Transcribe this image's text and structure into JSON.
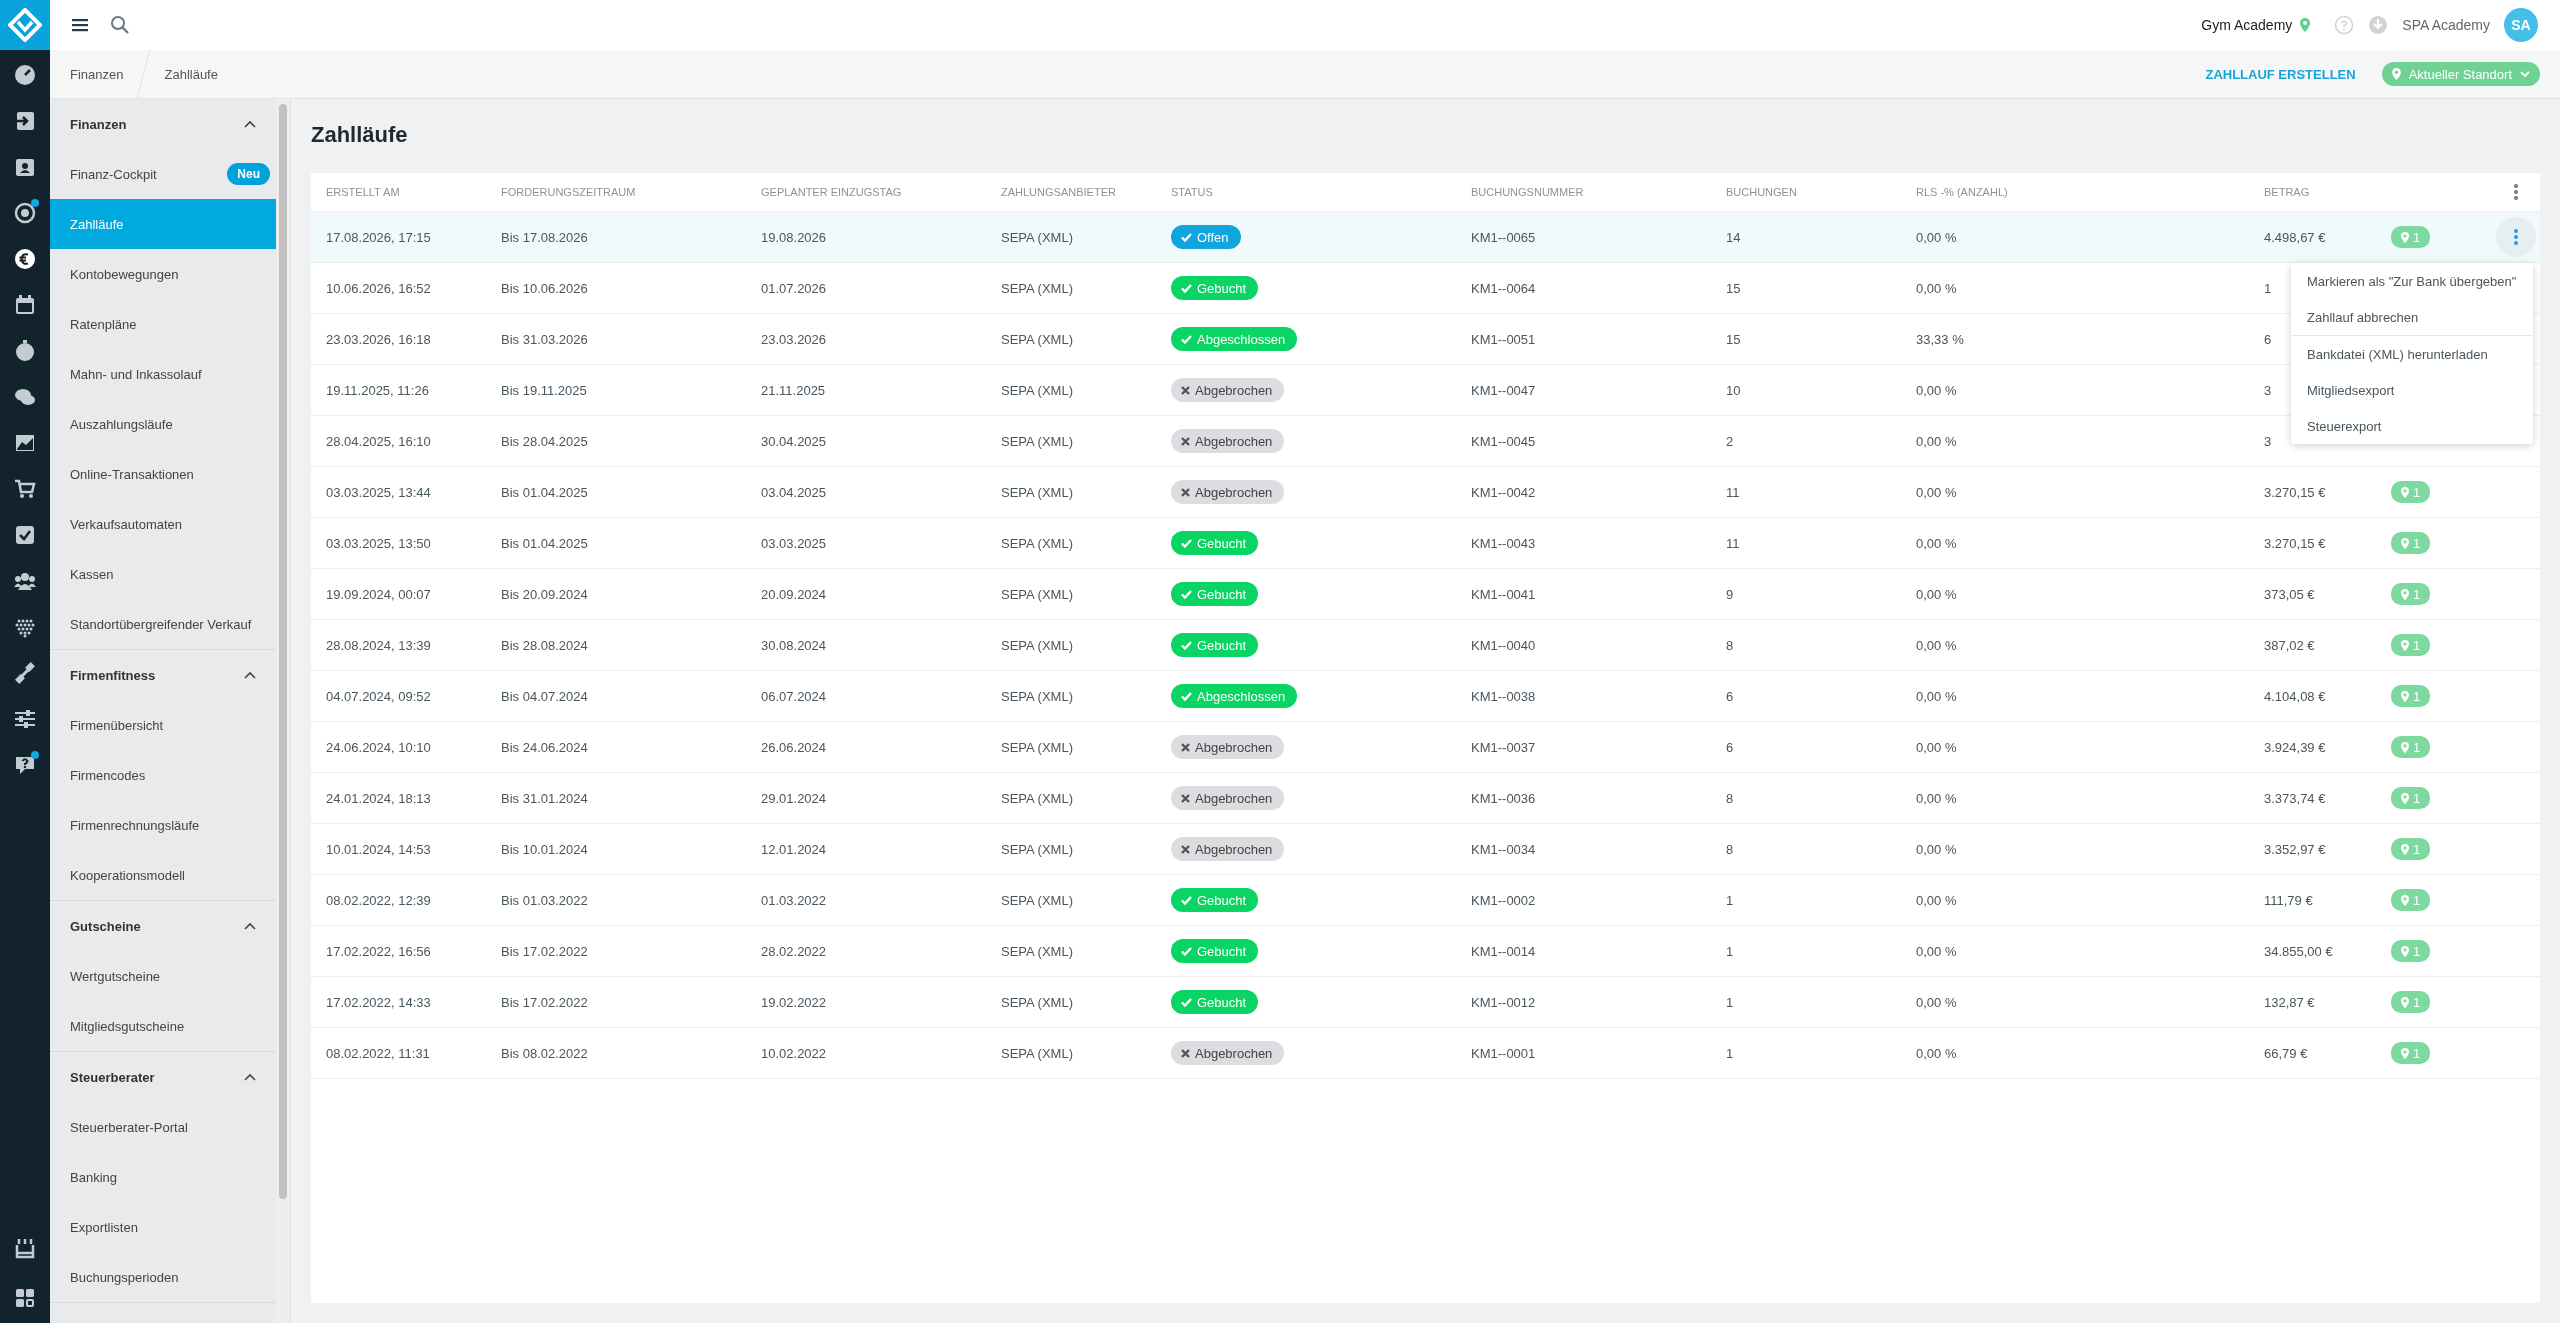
{
  "rail": {
    "top": [
      {
        "kind": "gauge",
        "selected": false,
        "dot": false
      },
      {
        "kind": "sign-in",
        "selected": false,
        "dot": false
      },
      {
        "kind": "contact",
        "selected": false,
        "dot": false
      },
      {
        "kind": "target",
        "selected": false,
        "dot": true
      },
      {
        "kind": "euro",
        "selected": true,
        "dot": false
      },
      {
        "kind": "calendar",
        "selected": false,
        "dot": false
      },
      {
        "kind": "stopwatch",
        "selected": false,
        "dot": false
      },
      {
        "kind": "chat",
        "selected": false,
        "dot": false
      },
      {
        "kind": "chart",
        "selected": false,
        "dot": false
      },
      {
        "kind": "cart",
        "selected": false,
        "dot": false
      },
      {
        "kind": "check",
        "selected": false,
        "dot": false
      },
      {
        "kind": "users",
        "selected": false,
        "dot": false
      },
      {
        "kind": "dots",
        "selected": false,
        "dot": false
      },
      {
        "kind": "dumbbell",
        "selected": false,
        "dot": false
      },
      {
        "kind": "sliders",
        "selected": false,
        "dot": false
      },
      {
        "kind": "help",
        "selected": false,
        "dot": true
      }
    ],
    "bottom": [
      {
        "kind": "store",
        "selected": false,
        "dot": false
      },
      {
        "kind": "grid",
        "selected": false,
        "dot": false
      }
    ]
  },
  "topbar": {
    "studio": "Gym Academy",
    "account": "SPA Academy",
    "avatar": "SA"
  },
  "breadcrumb": [
    "Finanzen",
    "Zahlläufe"
  ],
  "actions": {
    "create": "ZAHLLAUF ERSTELLEN",
    "location": "Aktueller Standort"
  },
  "sidebar": [
    {
      "title": "Finanzen",
      "expanded": true,
      "items": [
        {
          "label": "Finanz-Cockpit",
          "selected": false,
          "badge": "Neu"
        },
        {
          "label": "Zahlläufe",
          "selected": true
        },
        {
          "label": "Kontobewegungen",
          "selected": false
        },
        {
          "label": "Ratenpläne",
          "selected": false
        },
        {
          "label": "Mahn- und Inkassolauf",
          "selected": false
        },
        {
          "label": "Auszahlungsläufe",
          "selected": false
        },
        {
          "label": "Online-Transaktionen",
          "selected": false
        },
        {
          "label": "Verkaufsautomaten",
          "selected": false
        },
        {
          "label": "Kassen",
          "selected": false
        },
        {
          "label": "Standortübergreifender Verkauf",
          "selected": false
        }
      ]
    },
    {
      "title": "Firmenfitness",
      "expanded": true,
      "items": [
        {
          "label": "Firmenübersicht",
          "selected": false
        },
        {
          "label": "Firmencodes",
          "selected": false
        },
        {
          "label": "Firmenrechnungsläufe",
          "selected": false
        },
        {
          "label": "Kooperationsmodell",
          "selected": false
        }
      ]
    },
    {
      "title": "Gutscheine",
      "expanded": true,
      "items": [
        {
          "label": "Wertgutscheine",
          "selected": false
        },
        {
          "label": "Mitgliedsgutscheine",
          "selected": false
        }
      ]
    },
    {
      "title": "Steuerberater",
      "expanded": true,
      "items": [
        {
          "label": "Steuerberater-Portal",
          "selected": false
        },
        {
          "label": "Banking",
          "selected": false
        },
        {
          "label": "Exportlisten",
          "selected": false
        },
        {
          "label": "Buchungsperioden",
          "selected": false
        }
      ]
    }
  ],
  "page_title": "Zahlläufe",
  "table": {
    "columns": [
      "ERSTELLT AM",
      "FORDERUNGSZEITRAUM",
      "GEPLANTER EINZUGSTAG",
      "ZAHLUNGSANBIETER",
      "STATUS",
      "BUCHUNGSNUMMER",
      "BUCHUNGEN",
      "RLS -% (ANZAHL)",
      "BETRAG"
    ],
    "rows": [
      {
        "selected": true,
        "cells": [
          "17.08.2026, 17:15",
          "Bis 17.08.2026",
          "19.08.2026",
          "SEPA (XML)"
        ],
        "status": {
          "kind": "open",
          "label": "Offen"
        },
        "number": "KM1--0065",
        "bookings": "14",
        "rls": "0,00 %",
        "amount": "4.498,67 €",
        "locations": "1",
        "menu": {
          "groups": [
            [
              "Markieren als \"Zur Bank übergeben\"",
              "Zahllauf abbrechen"
            ],
            [
              "Bankdatei (XML) herunterladen",
              "Mitgliedsexport",
              "Steuerexport"
            ]
          ]
        }
      },
      {
        "selected": false,
        "cells": [
          "10.06.2026, 16:52",
          "Bis 10.06.2026",
          "01.07.2026",
          "SEPA (XML)"
        ],
        "status": {
          "kind": "booked",
          "label": "Gebucht"
        },
        "number": "KM1--0064",
        "bookings": "15",
        "rls": "0,00 %",
        "amount": "1"
      },
      {
        "selected": false,
        "cells": [
          "23.03.2026, 16:18",
          "Bis 31.03.2026",
          "23.03.2026",
          "SEPA (XML)"
        ],
        "status": {
          "kind": "closed",
          "label": "Abgeschlossen"
        },
        "number": "KM1--0051",
        "bookings": "15",
        "rls": "33,33 %",
        "amount": "6"
      },
      {
        "selected": false,
        "cells": [
          "19.11.2025, 11:26",
          "Bis 19.11.2025",
          "21.11.2025",
          "SEPA (XML)"
        ],
        "status": {
          "kind": "cancelled",
          "label": "Abgebrochen"
        },
        "number": "KM1--0047",
        "bookings": "10",
        "rls": "0,00 %",
        "amount": "3"
      },
      {
        "selected": false,
        "cells": [
          "28.04.2025, 16:10",
          "Bis 28.04.2025",
          "30.04.2025",
          "SEPA (XML)"
        ],
        "status": {
          "kind": "cancelled",
          "label": "Abgebrochen"
        },
        "number": "KM1--0045",
        "bookings": "2",
        "rls": "0,00 %",
        "amount": "3"
      },
      {
        "selected": false,
        "cells": [
          "03.03.2025, 13:44",
          "Bis 01.04.2025",
          "03.04.2025",
          "SEPA (XML)"
        ],
        "status": {
          "kind": "cancelled",
          "label": "Abgebrochen"
        },
        "number": "KM1--0042",
        "bookings": "11",
        "rls": "0,00 %",
        "amount": "3.270,15 €",
        "locations": "1"
      },
      {
        "selected": false,
        "cells": [
          "03.03.2025, 13:50",
          "Bis 01.04.2025",
          "03.03.2025",
          "SEPA (XML)"
        ],
        "status": {
          "kind": "booked",
          "label": "Gebucht"
        },
        "number": "KM1--0043",
        "bookings": "11",
        "rls": "0,00 %",
        "amount": "3.270,15 €",
        "locations": "1"
      },
      {
        "selected": false,
        "cells": [
          "19.09.2024, 00:07",
          "Bis 20.09.2024",
          "20.09.2024",
          "SEPA (XML)"
        ],
        "status": {
          "kind": "booked",
          "label": "Gebucht"
        },
        "number": "KM1--0041",
        "bookings": "9",
        "rls": "0,00 %",
        "amount": "373,05 €",
        "locations": "1"
      },
      {
        "selected": false,
        "cells": [
          "28.08.2024, 13:39",
          "Bis 28.08.2024",
          "30.08.2024",
          "SEPA (XML)"
        ],
        "status": {
          "kind": "booked",
          "label": "Gebucht"
        },
        "number": "KM1--0040",
        "bookings": "8",
        "rls": "0,00 %",
        "amount": "387,02 €",
        "locations": "1"
      },
      {
        "selected": false,
        "cells": [
          "04.07.2024, 09:52",
          "Bis 04.07.2024",
          "06.07.2024",
          "SEPA (XML)"
        ],
        "status": {
          "kind": "closed",
          "label": "Abgeschlossen"
        },
        "number": "KM1--0038",
        "bookings": "6",
        "rls": "0,00 %",
        "amount": "4.104,08 €",
        "locations": "1"
      },
      {
        "selected": false,
        "cells": [
          "24.06.2024, 10:10",
          "Bis 24.06.2024",
          "26.06.2024",
          "SEPA (XML)"
        ],
        "status": {
          "kind": "cancelled",
          "label": "Abgebrochen"
        },
        "number": "KM1--0037",
        "bookings": "6",
        "rls": "0,00 %",
        "amount": "3.924,39 €",
        "locations": "1"
      },
      {
        "selected": false,
        "cells": [
          "24.01.2024, 18:13",
          "Bis 31.01.2024",
          "29.01.2024",
          "SEPA (XML)"
        ],
        "status": {
          "kind": "cancelled",
          "label": "Abgebrochen"
        },
        "number": "KM1--0036",
        "bookings": "8",
        "rls": "0,00 %",
        "amount": "3.373,74 €",
        "locations": "1"
      },
      {
        "selected": false,
        "cells": [
          "10.01.2024, 14:53",
          "Bis 10.01.2024",
          "12.01.2024",
          "SEPA (XML)"
        ],
        "status": {
          "kind": "cancelled",
          "label": "Abgebrochen"
        },
        "number": "KM1--0034",
        "bookings": "8",
        "rls": "0,00 %",
        "amount": "3.352,97 €",
        "locations": "1"
      },
      {
        "selected": false,
        "cells": [
          "08.02.2022, 12:39",
          "Bis 01.03.2022",
          "01.03.2022",
          "SEPA (XML)"
        ],
        "status": {
          "kind": "booked",
          "label": "Gebucht"
        },
        "number": "KM1--0002",
        "bookings": "1",
        "rls": "0,00 %",
        "amount": "111,79 €",
        "locations": "1"
      },
      {
        "selected": false,
        "cells": [
          "17.02.2022, 16:56",
          "Bis 17.02.2022",
          "28.02.2022",
          "SEPA (XML)"
        ],
        "status": {
          "kind": "booked",
          "label": "Gebucht"
        },
        "number": "KM1--0014",
        "bookings": "1",
        "rls": "0,00 %",
        "amount": "34.855,00 €",
        "locations": "1"
      },
      {
        "selected": false,
        "cells": [
          "17.02.2022, 14:33",
          "Bis 17.02.2022",
          "19.02.2022",
          "SEPA (XML)"
        ],
        "status": {
          "kind": "booked",
          "label": "Gebucht"
        },
        "number": "KM1--0012",
        "bookings": "1",
        "rls": "0,00 %",
        "amount": "132,87 €",
        "locations": "1"
      },
      {
        "selected": false,
        "cells": [
          "08.02.2022, 11:31",
          "Bis 08.02.2022",
          "10.02.2022",
          "SEPA (XML)"
        ],
        "status": {
          "kind": "cancelled",
          "label": "Abgebrochen"
        },
        "number": "KM1--0001",
        "bookings": "1",
        "rls": "0,00 %",
        "amount": "66,79 €",
        "locations": "1"
      }
    ]
  }
}
